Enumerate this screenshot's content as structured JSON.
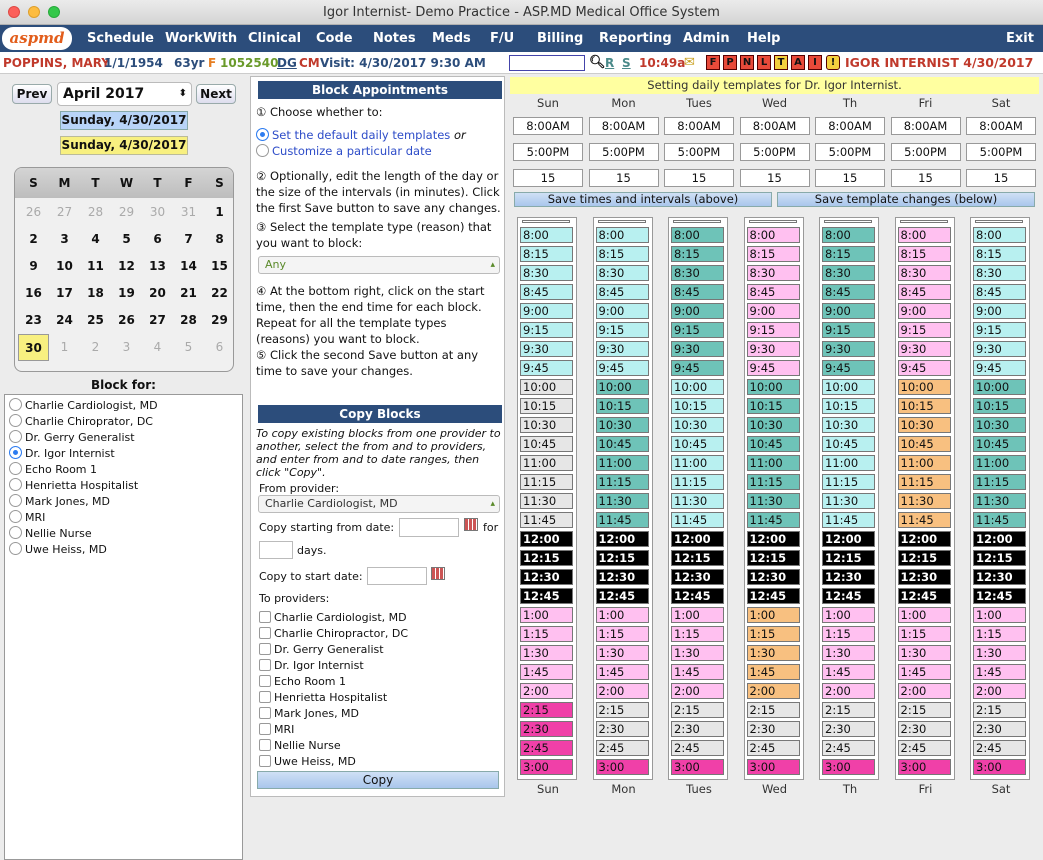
{
  "window_title": "Igor Internist- Demo Practice - ASP.MD Medical Office System",
  "logo_text": "aspmd",
  "menu": [
    "Schedule",
    "WorkWith",
    "Clinical",
    "Code",
    "Notes",
    "Meds",
    "F/U",
    "Billing",
    "Reporting",
    "Admin",
    "Help",
    "Exit"
  ],
  "patient": {
    "name": "POPPINS, MARY",
    "dob": "1/1/1954",
    "age": "63yr",
    "sex": "F",
    "id": "1052540",
    "dg": "DG",
    "cm": "CM",
    "visit": "Visit: 4/30/2017 9:30 AM",
    "search_icons": [
      "R",
      "S"
    ],
    "time": "10:49a",
    "flags": [
      "F",
      "P",
      "N",
      "L",
      "T",
      "A",
      "I",
      "!"
    ],
    "provider_date": "IGOR INTERNIST 4/30/2017"
  },
  "calendar": {
    "prev": "Prev",
    "next": "Next",
    "month": "April 2017",
    "date1": "Sunday, 4/30/2017",
    "date2": "Sunday, 4/30/2017",
    "dow": [
      "S",
      "M",
      "T",
      "W",
      "T",
      "F",
      "S"
    ],
    "days": [
      [
        "26",
        "27",
        "28",
        "29",
        "30",
        "31",
        "1"
      ],
      [
        "2",
        "3",
        "4",
        "5",
        "6",
        "7",
        "8"
      ],
      [
        "9",
        "10",
        "11",
        "12",
        "13",
        "14",
        "15"
      ],
      [
        "16",
        "17",
        "18",
        "19",
        "20",
        "21",
        "22"
      ],
      [
        "23",
        "24",
        "25",
        "26",
        "27",
        "28",
        "29"
      ],
      [
        "30",
        "1",
        "2",
        "3",
        "4",
        "5",
        "6"
      ]
    ]
  },
  "block_for": {
    "label": "Block for:",
    "providers": [
      "Charlie Cardiologist, MD",
      "Charlie Chiroprator, DC",
      "Dr. Gerry Generalist",
      "Dr. Igor Internist",
      "Echo Room 1",
      "Henrietta Hospitalist",
      "Mark Jones, MD",
      "MRI",
      "Nellie Nurse",
      "Uwe Heiss, MD"
    ],
    "selected": "Dr. Igor Internist"
  },
  "block_appointments": {
    "title": "Block Appointments",
    "step1": "① Choose whether to:",
    "opt1": "Set the default daily templates",
    "opt1_or": "or",
    "opt2": "Customize a particular date",
    "step2": "② Optionally, edit the length of the day or the size of the intervals (in minutes). Click the first Save button to save any changes.",
    "step3": "③ Select the template type (reason) that you want to block:",
    "type_value": "Any",
    "step4": "④ At the bottom right, click on the start time, then the end time for each block. Repeat for all the template types (reasons) you want to block.",
    "step5": "⑤ Click the second Save button at any time to save your changes."
  },
  "copy_blocks": {
    "title": "Copy Blocks",
    "desc": "To copy existing blocks from one provider to another, select the from and to providers, and enter from and to date ranges, then click \"Copy\".",
    "from_label": "From provider:",
    "from_value": "Charlie Cardiologist, MD",
    "start_label": "Copy starting from date:",
    "for_label": "for",
    "days_label": "days.",
    "to_start_label": "Copy to start date:",
    "to_providers_label": "To providers:",
    "to_providers": [
      "Charlie Cardiologist, MD",
      "Charlie Chiropractor, DC",
      "Dr. Gerry Generalist",
      "Dr. Igor Internist",
      "Echo Room 1",
      "Henrietta Hospitalist",
      "Mark Jones, MD",
      "MRI",
      "Nellie Nurse",
      "Uwe Heiss, MD"
    ],
    "copy_button": "Copy"
  },
  "template": {
    "banner": "Setting daily templates for Dr. Igor Internist.",
    "days": [
      "Sun",
      "Mon",
      "Tues",
      "Wed",
      "Th",
      "Fri",
      "Sat"
    ],
    "start": "8:00AM",
    "end": "5:00PM",
    "interval": "15",
    "save_times": "Save times and intervals (above)",
    "save_template": "Save template changes (below)",
    "times": [
      "8:00",
      "8:15",
      "8:30",
      "8:45",
      "9:00",
      "9:15",
      "9:30",
      "9:45",
      "10:00",
      "10:15",
      "10:30",
      "10:45",
      "11:00",
      "11:15",
      "11:30",
      "11:45",
      "12:00",
      "12:15",
      "12:30",
      "12:45",
      "1:00",
      "1:15",
      "1:30",
      "1:45",
      "2:00",
      "2:15",
      "2:30",
      "2:45",
      "3:00"
    ],
    "colors": {
      "c": "#b8f0f0",
      "t": "#6ec3b8",
      "p": "#ffc0f0",
      "o": "#f8c080",
      "g": "#e6e6e6",
      "k": "#000000",
      "m": "#f040a8"
    },
    "patterns": [
      "cccccccc gggggggg kkkk ppppp mmmm",
      "cccccccc tttttttt kkkk ppppp gggm",
      "tttttttt cccccccc kkkk ppppp gggm",
      "pppppppp tttttttt kkkk ooooo gggm",
      "tttttttt cccccccc kkkk ppppp gggm",
      "pppppppp oooooooo kkkk ppppp gggm",
      "cccccccc tttttttt kkkk ppppp gggm"
    ]
  }
}
